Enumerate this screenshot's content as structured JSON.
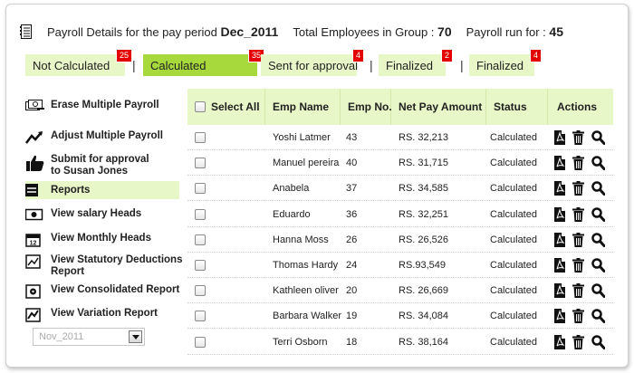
{
  "header": {
    "label_period": "Payroll Details for the pay period",
    "period_value": "Dec_2011",
    "label_total": "Total Employees in Group :",
    "total_value": "70",
    "label_run": "Payroll run for :",
    "run_value": "45"
  },
  "tabs": [
    {
      "label": "Not Calculated",
      "count": "25"
    },
    {
      "label": "Calculated",
      "count": "35"
    },
    {
      "label": "Sent for approval",
      "count": "4"
    },
    {
      "label": "Finalized",
      "count": "2"
    },
    {
      "label": "Finalized",
      "count": "4"
    }
  ],
  "tab_separator": "|",
  "menu": [
    {
      "label": "Erase Multiple Payroll",
      "icon": "erase-money-icon"
    },
    {
      "label": "Adjust Multiple Payroll",
      "icon": "adjust-arrows-icon"
    },
    {
      "label": "Submit for approval to Susan Jones",
      "line1": "Submit for approval",
      "line2": "to Susan Jones",
      "icon": "thumbs-up-icon"
    },
    {
      "label": "Reports",
      "icon": "report-lines-icon"
    },
    {
      "label": "View salary Heads",
      "icon": "money-note-icon"
    },
    {
      "label": "View Monthly  Heads",
      "icon": "calendar-icon"
    },
    {
      "label": "View Statutory Deductions Report",
      "line1": "View Statutory Deductions",
      "line2": "Report",
      "icon": "line-chart-icon"
    },
    {
      "label": "View Consolidated Report",
      "icon": "consolidated-icon"
    },
    {
      "label": "View Variation Report",
      "icon": "variation-chart-icon"
    }
  ],
  "period_select": {
    "value": "Nov_2011"
  },
  "table": {
    "headers": [
      "Select All",
      "Emp Name",
      "Emp No.",
      "Net Pay Amount",
      "Status",
      "Actions"
    ],
    "rows": [
      {
        "name": "Yoshi Latmer",
        "no": "43",
        "pay": "RS. 32,213",
        "status": "Calculated"
      },
      {
        "name": "Manuel pereira",
        "no": "40",
        "pay": "RS. 31,715",
        "status": "Calculated"
      },
      {
        "name": "Anabela",
        "no": "37",
        "pay": "RS. 34,585",
        "status": "Calculated"
      },
      {
        "name": "Eduardo",
        "no": "36",
        "pay": "RS. 32,251",
        "status": "Calculated"
      },
      {
        "name": "Hanna Moss",
        "no": "26",
        "pay": "RS. 26,526",
        "status": "Calculated"
      },
      {
        "name": "Thomas Hardy",
        "no": "24",
        "pay": "RS.93,549",
        "status": "Calculated"
      },
      {
        "name": "Kathleen oliver",
        "no": "20",
        "pay": "RS. 26,669",
        "status": "Calculated"
      },
      {
        "name": "Barbara Walker",
        "no": "19",
        "pay": "RS. 34,084",
        "status": "Calculated"
      },
      {
        "name": "Terri Osborn",
        "no": "18",
        "pay": "RS. 38,164",
        "status": "Calculated"
      }
    ],
    "row_action_icons": [
      "pdf-document-icon",
      "trash-icon",
      "magnifier-icon"
    ]
  },
  "colors": {
    "tab_bg": "#e8f7c8",
    "tab_active": "#a7d93c",
    "badge": "#e40000"
  }
}
